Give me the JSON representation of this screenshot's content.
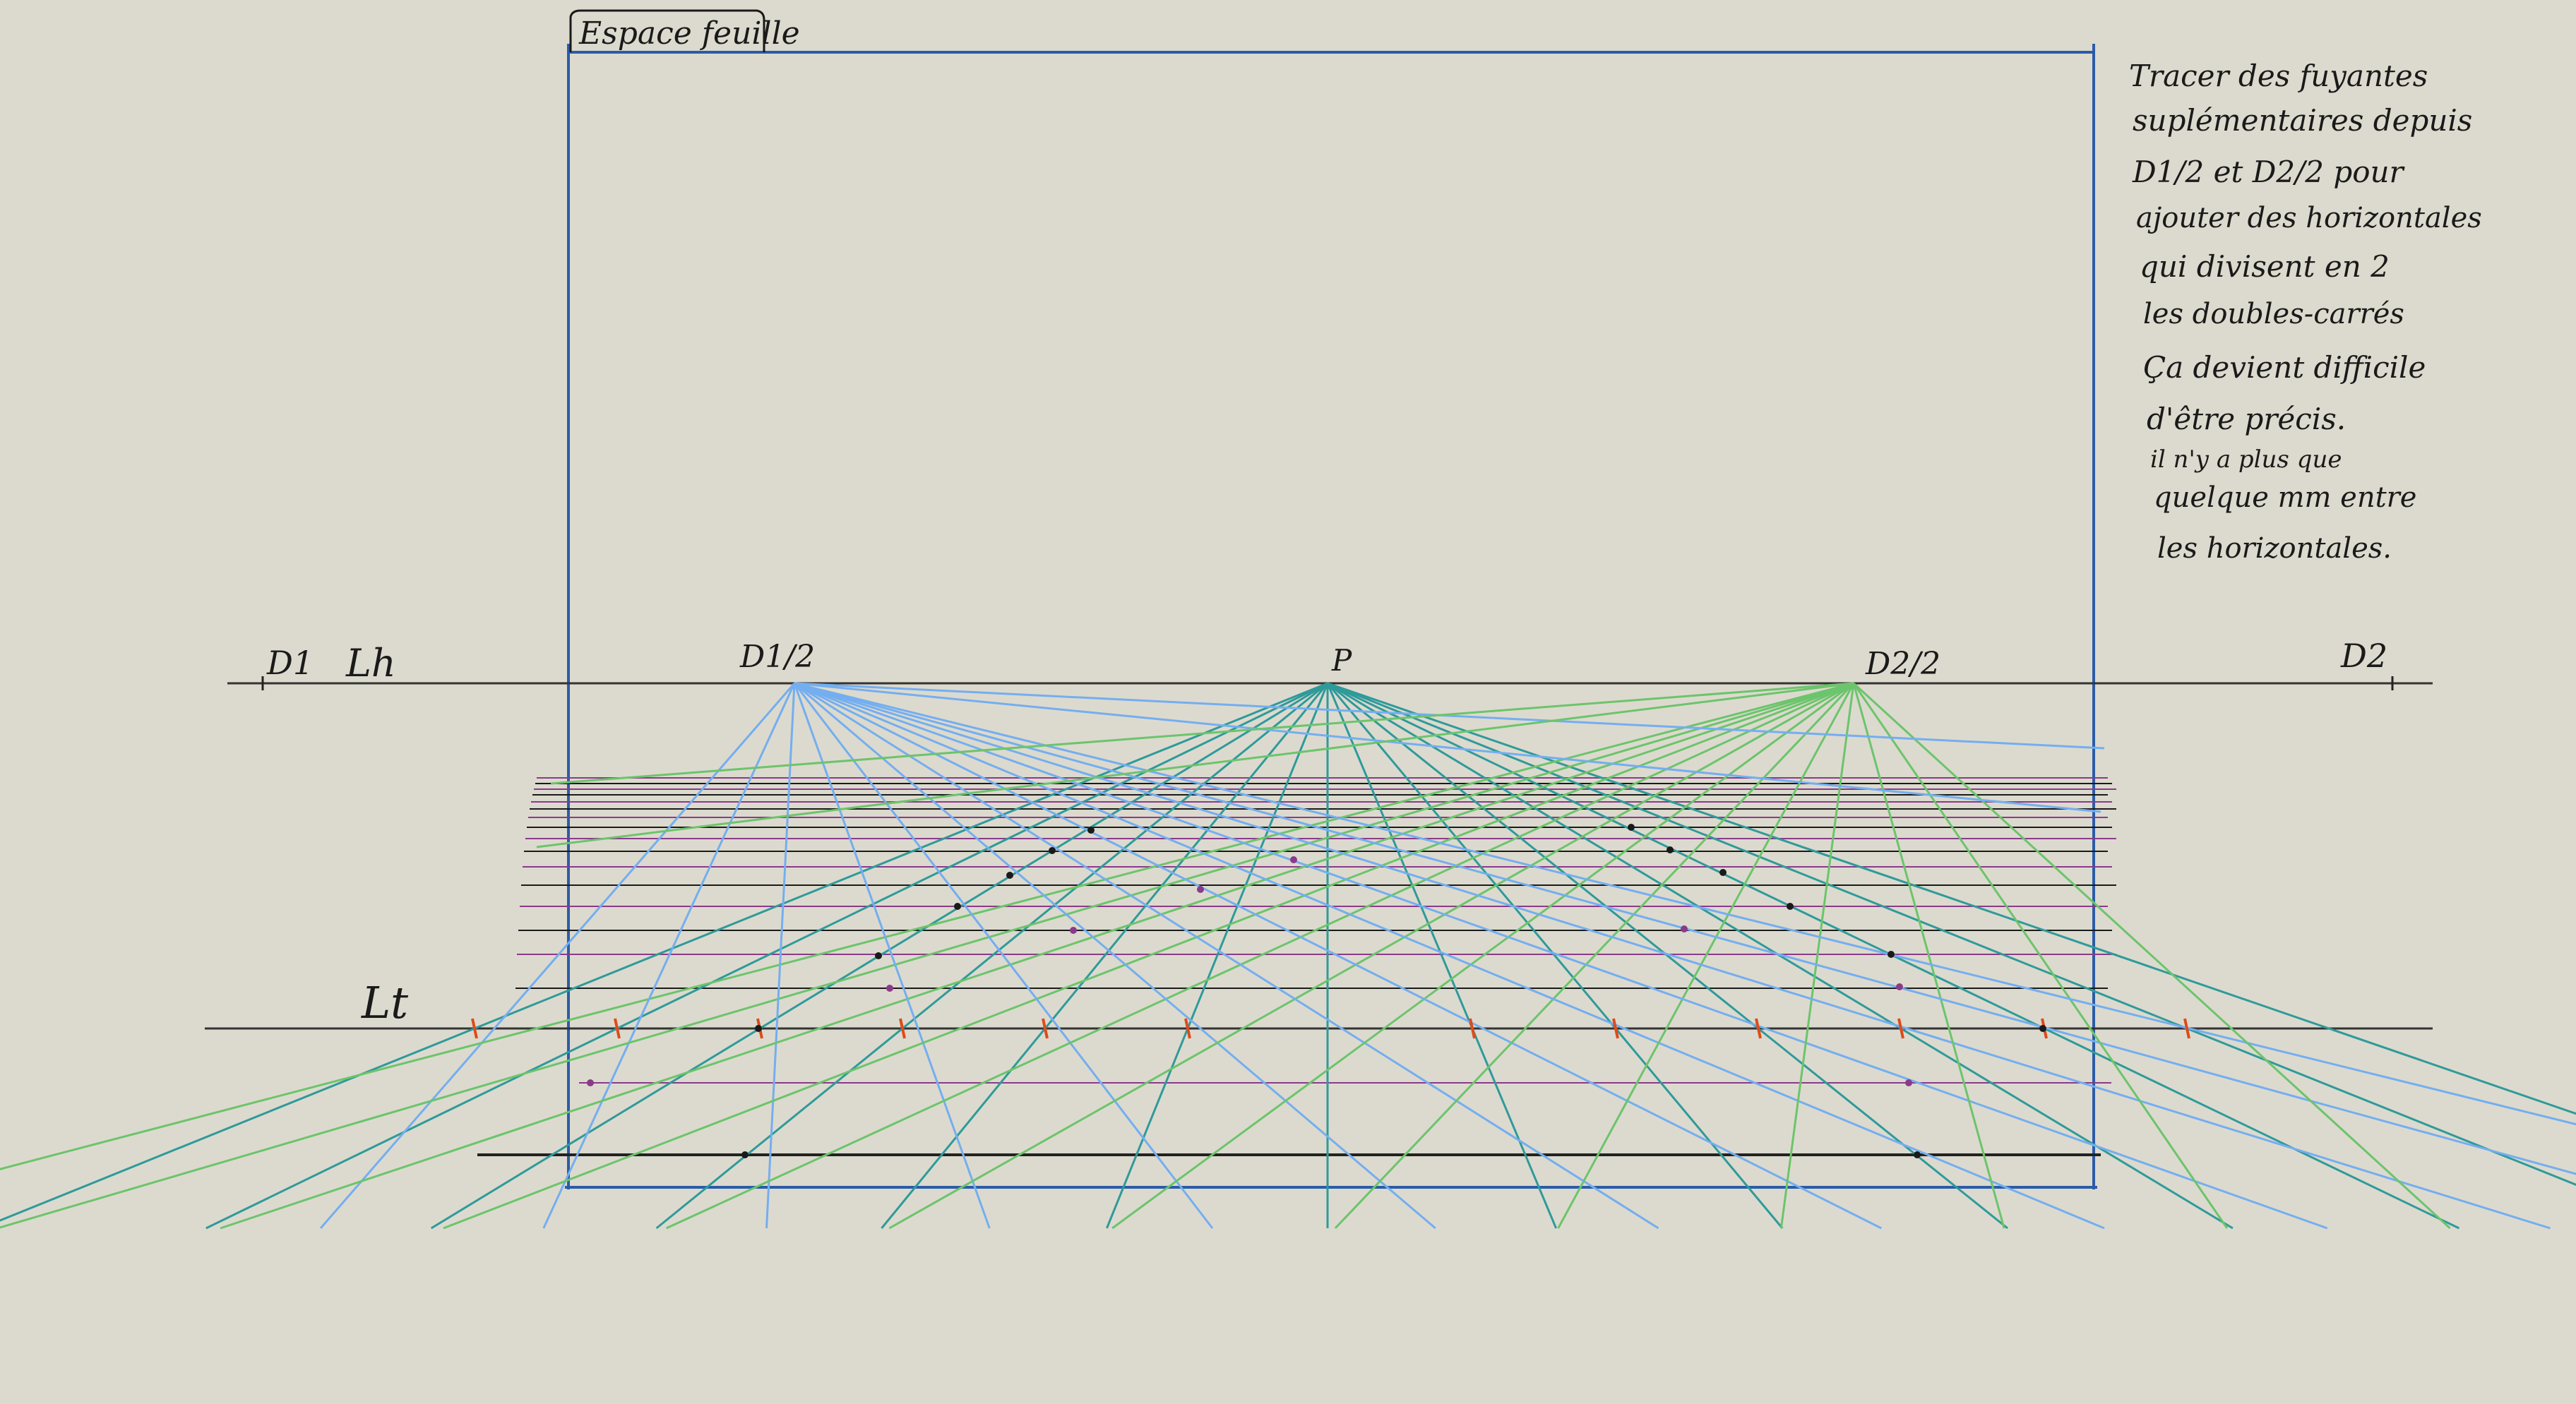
{
  "labels": {
    "title_box": "Espace feuille",
    "horizon_line": "Lh",
    "ground_line": "Lt",
    "d1": "D1",
    "d_half_1": "D1/2",
    "principal_point": "P",
    "d_half_2": "D2/2",
    "d2": "D2"
  },
  "notes": [
    "Tracer des fuyantes",
    "suplémentaires depuis",
    "D1/2 et D2/2 pour",
    "ajouter des horizontales",
    "qui divisent en 2",
    "les doubles-carrés",
    "Ça devient difficile",
    "d'être précis.",
    "il n'y a plus que",
    "quelque mm entre",
    "les horizontales."
  ],
  "colors": {
    "background": "#dcdace",
    "frame": "#2a5ca8",
    "ink": "#1a1a1a",
    "fuyantes_p": "#2f9a9a",
    "fuyantes_d_half_1": "#74aef0",
    "fuyantes_d_half_2": "#6cc46c",
    "horizontals": "#8a3a8a",
    "ticks": "#e04a1a"
  }
}
